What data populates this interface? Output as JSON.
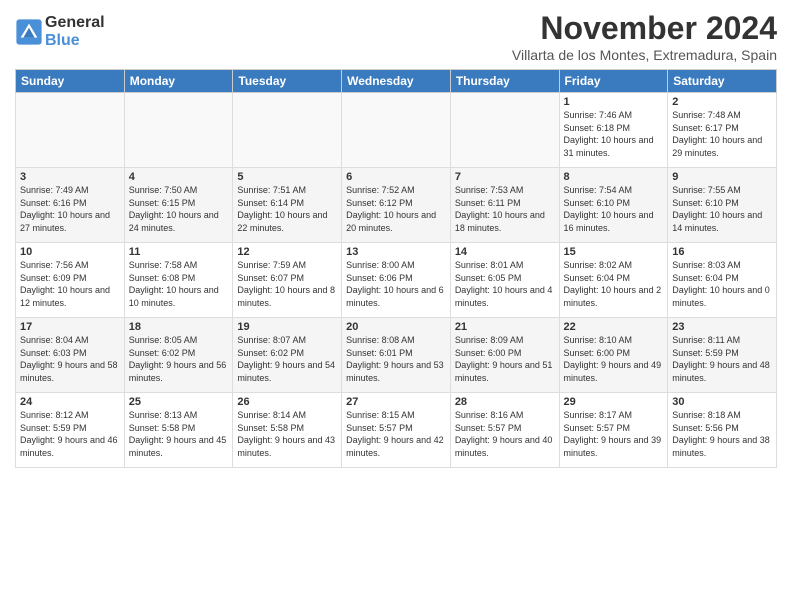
{
  "logo": {
    "line1": "General",
    "line2": "Blue"
  },
  "title": "November 2024",
  "subtitle": "Villarta de los Montes, Extremadura, Spain",
  "headers": [
    "Sunday",
    "Monday",
    "Tuesday",
    "Wednesday",
    "Thursday",
    "Friday",
    "Saturday"
  ],
  "weeks": [
    [
      {
        "day": "",
        "info": ""
      },
      {
        "day": "",
        "info": ""
      },
      {
        "day": "",
        "info": ""
      },
      {
        "day": "",
        "info": ""
      },
      {
        "day": "",
        "info": ""
      },
      {
        "day": "1",
        "info": "Sunrise: 7:46 AM\nSunset: 6:18 PM\nDaylight: 10 hours and 31 minutes."
      },
      {
        "day": "2",
        "info": "Sunrise: 7:48 AM\nSunset: 6:17 PM\nDaylight: 10 hours and 29 minutes."
      }
    ],
    [
      {
        "day": "3",
        "info": "Sunrise: 7:49 AM\nSunset: 6:16 PM\nDaylight: 10 hours and 27 minutes."
      },
      {
        "day": "4",
        "info": "Sunrise: 7:50 AM\nSunset: 6:15 PM\nDaylight: 10 hours and 24 minutes."
      },
      {
        "day": "5",
        "info": "Sunrise: 7:51 AM\nSunset: 6:14 PM\nDaylight: 10 hours and 22 minutes."
      },
      {
        "day": "6",
        "info": "Sunrise: 7:52 AM\nSunset: 6:12 PM\nDaylight: 10 hours and 20 minutes."
      },
      {
        "day": "7",
        "info": "Sunrise: 7:53 AM\nSunset: 6:11 PM\nDaylight: 10 hours and 18 minutes."
      },
      {
        "day": "8",
        "info": "Sunrise: 7:54 AM\nSunset: 6:10 PM\nDaylight: 10 hours and 16 minutes."
      },
      {
        "day": "9",
        "info": "Sunrise: 7:55 AM\nSunset: 6:10 PM\nDaylight: 10 hours and 14 minutes."
      }
    ],
    [
      {
        "day": "10",
        "info": "Sunrise: 7:56 AM\nSunset: 6:09 PM\nDaylight: 10 hours and 12 minutes."
      },
      {
        "day": "11",
        "info": "Sunrise: 7:58 AM\nSunset: 6:08 PM\nDaylight: 10 hours and 10 minutes."
      },
      {
        "day": "12",
        "info": "Sunrise: 7:59 AM\nSunset: 6:07 PM\nDaylight: 10 hours and 8 minutes."
      },
      {
        "day": "13",
        "info": "Sunrise: 8:00 AM\nSunset: 6:06 PM\nDaylight: 10 hours and 6 minutes."
      },
      {
        "day": "14",
        "info": "Sunrise: 8:01 AM\nSunset: 6:05 PM\nDaylight: 10 hours and 4 minutes."
      },
      {
        "day": "15",
        "info": "Sunrise: 8:02 AM\nSunset: 6:04 PM\nDaylight: 10 hours and 2 minutes."
      },
      {
        "day": "16",
        "info": "Sunrise: 8:03 AM\nSunset: 6:04 PM\nDaylight: 10 hours and 0 minutes."
      }
    ],
    [
      {
        "day": "17",
        "info": "Sunrise: 8:04 AM\nSunset: 6:03 PM\nDaylight: 9 hours and 58 minutes."
      },
      {
        "day": "18",
        "info": "Sunrise: 8:05 AM\nSunset: 6:02 PM\nDaylight: 9 hours and 56 minutes."
      },
      {
        "day": "19",
        "info": "Sunrise: 8:07 AM\nSunset: 6:02 PM\nDaylight: 9 hours and 54 minutes."
      },
      {
        "day": "20",
        "info": "Sunrise: 8:08 AM\nSunset: 6:01 PM\nDaylight: 9 hours and 53 minutes."
      },
      {
        "day": "21",
        "info": "Sunrise: 8:09 AM\nSunset: 6:00 PM\nDaylight: 9 hours and 51 minutes."
      },
      {
        "day": "22",
        "info": "Sunrise: 8:10 AM\nSunset: 6:00 PM\nDaylight: 9 hours and 49 minutes."
      },
      {
        "day": "23",
        "info": "Sunrise: 8:11 AM\nSunset: 5:59 PM\nDaylight: 9 hours and 48 minutes."
      }
    ],
    [
      {
        "day": "24",
        "info": "Sunrise: 8:12 AM\nSunset: 5:59 PM\nDaylight: 9 hours and 46 minutes."
      },
      {
        "day": "25",
        "info": "Sunrise: 8:13 AM\nSunset: 5:58 PM\nDaylight: 9 hours and 45 minutes."
      },
      {
        "day": "26",
        "info": "Sunrise: 8:14 AM\nSunset: 5:58 PM\nDaylight: 9 hours and 43 minutes."
      },
      {
        "day": "27",
        "info": "Sunrise: 8:15 AM\nSunset: 5:57 PM\nDaylight: 9 hours and 42 minutes."
      },
      {
        "day": "28",
        "info": "Sunrise: 8:16 AM\nSunset: 5:57 PM\nDaylight: 9 hours and 40 minutes."
      },
      {
        "day": "29",
        "info": "Sunrise: 8:17 AM\nSunset: 5:57 PM\nDaylight: 9 hours and 39 minutes."
      },
      {
        "day": "30",
        "info": "Sunrise: 8:18 AM\nSunset: 5:56 PM\nDaylight: 9 hours and 38 minutes."
      }
    ]
  ]
}
